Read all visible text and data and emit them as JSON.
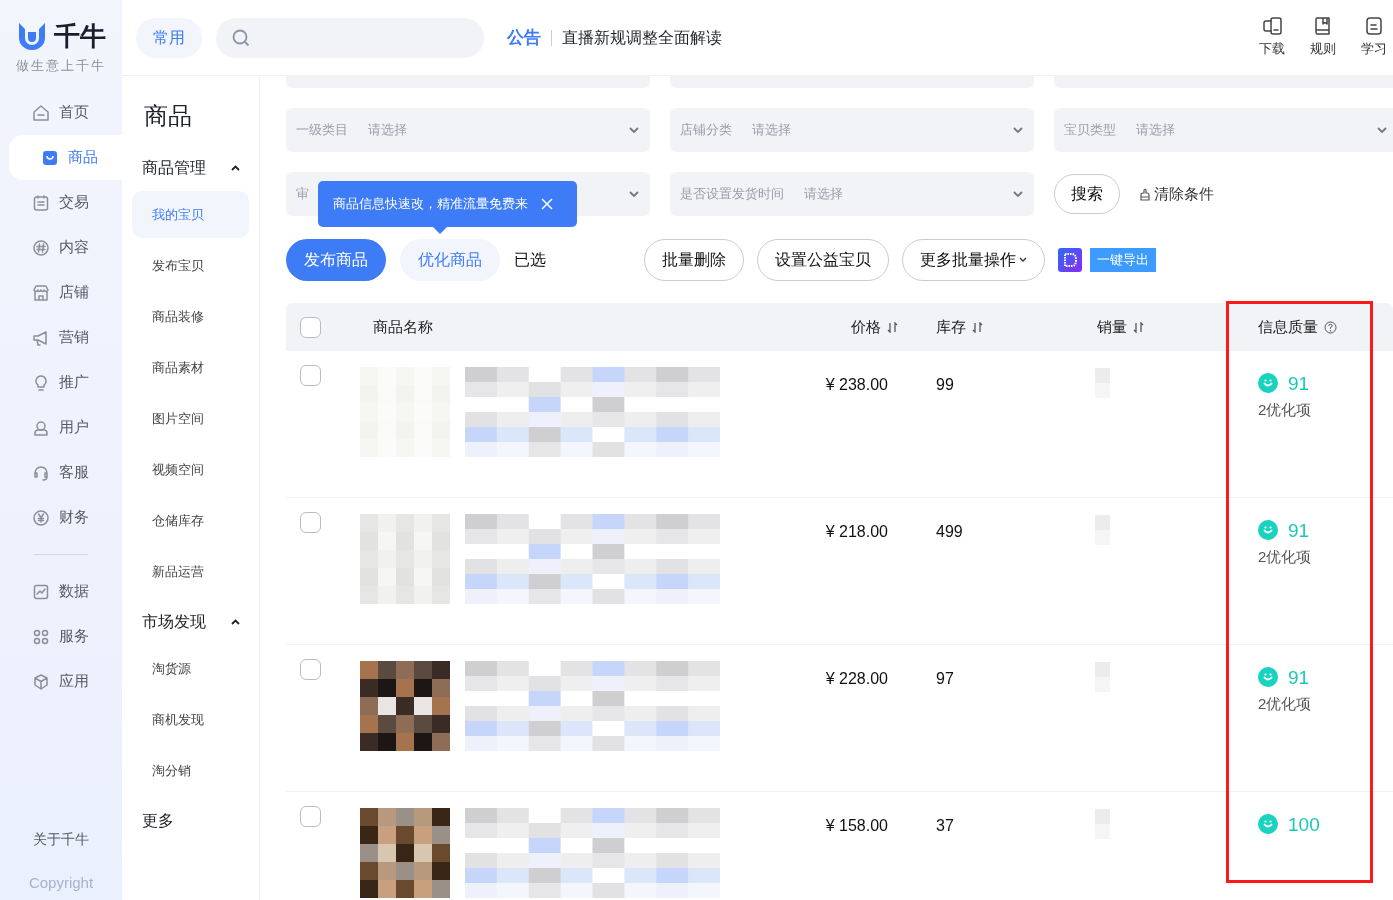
{
  "brand": {
    "name": "千牛",
    "slogan": "做生意上千牛"
  },
  "main_nav": {
    "primary": [
      {
        "label": "首页",
        "selected": false
      },
      {
        "label": "商品",
        "selected": true
      },
      {
        "label": "交易",
        "selected": false
      },
      {
        "label": "内容",
        "selected": false
      },
      {
        "label": "店铺",
        "selected": false
      },
      {
        "label": "营销",
        "selected": false
      },
      {
        "label": "推广",
        "selected": false
      },
      {
        "label": "用户",
        "selected": false
      },
      {
        "label": "客服",
        "selected": false
      },
      {
        "label": "财务",
        "selected": false
      }
    ],
    "secondary": [
      {
        "label": "数据",
        "selected": false
      },
      {
        "label": "服务",
        "selected": false
      },
      {
        "label": "应用",
        "selected": false
      }
    ],
    "footer": [
      "关于千牛",
      "Copyright"
    ]
  },
  "header": {
    "quick_button": "常用",
    "announcement": {
      "label": "公告",
      "text": "直播新规调整全面解读"
    },
    "tools": [
      {
        "label": "下载"
      },
      {
        "label": "规则"
      },
      {
        "label": "学习"
      }
    ]
  },
  "sub_nav": {
    "title": "商品",
    "sections": [
      {
        "label": "商品管理",
        "expanded": true,
        "children": [
          {
            "label": "我的宝贝",
            "selected": true
          },
          {
            "label": "发布宝贝",
            "selected": false
          },
          {
            "label": "商品装修",
            "selected": false
          },
          {
            "label": "商品素材",
            "selected": false
          },
          {
            "label": "图片空间",
            "selected": false
          },
          {
            "label": "视频空间",
            "selected": false
          },
          {
            "label": "仓储库存",
            "selected": false
          },
          {
            "label": "新品运营",
            "selected": false
          }
        ]
      },
      {
        "label": "市场发现",
        "expanded": true,
        "children": [
          {
            "label": "淘货源",
            "selected": false
          },
          {
            "label": "商机发现",
            "selected": false
          },
          {
            "label": "淘分销",
            "selected": false
          }
        ]
      },
      {
        "label": "更多"
      }
    ]
  },
  "filters": [
    {
      "label": "一级类目",
      "placeholder": "请选择"
    },
    {
      "label": "店铺分类",
      "placeholder": "请选择"
    },
    {
      "label": "宝贝类型",
      "placeholder": "请选择"
    },
    {
      "label": "审"
    },
    {
      "label": "是否设置发货时间",
      "placeholder": "请选择"
    }
  ],
  "filter_actions": {
    "search": "搜索",
    "clear": "清除条件"
  },
  "tooltip": {
    "text": "商品信息快速改，精准流量免费来"
  },
  "actions": [
    {
      "kind": "primary",
      "label": "发布商品"
    },
    {
      "kind": "soft",
      "label": "优化商品"
    },
    {
      "kind": "text",
      "label": "已选"
    },
    {
      "kind": "outline",
      "label": "批量删除"
    },
    {
      "kind": "outline",
      "label": "设置公益宝贝"
    },
    {
      "kind": "dropdown",
      "label": "更多批量操作"
    },
    {
      "kind": "app"
    },
    {
      "kind": "export",
      "label": "一键导出"
    }
  ],
  "table": {
    "header_checked": false,
    "columns": [
      {
        "label": "商品名称"
      },
      {
        "label": "价格",
        "sortable": true
      },
      {
        "label": "库存",
        "sortable": true
      },
      {
        "label": "销量",
        "sortable": true
      },
      {
        "label": "信息质量",
        "help": true,
        "highlighted": true
      }
    ],
    "rows": [
      {
        "checked": false,
        "price": "¥ 238.00",
        "stock": "99",
        "quality_score": "91",
        "quality_note": "2优化项"
      },
      {
        "checked": false,
        "price": "¥ 218.00",
        "stock": "499",
        "quality_score": "91",
        "quality_note": "2优化项"
      },
      {
        "checked": false,
        "price": "¥ 228.00",
        "stock": "97",
        "quality_score": "91",
        "quality_note": "2优化项"
      },
      {
        "checked": false,
        "price": "¥ 158.00",
        "stock": "37",
        "quality_score": "100"
      }
    ]
  }
}
